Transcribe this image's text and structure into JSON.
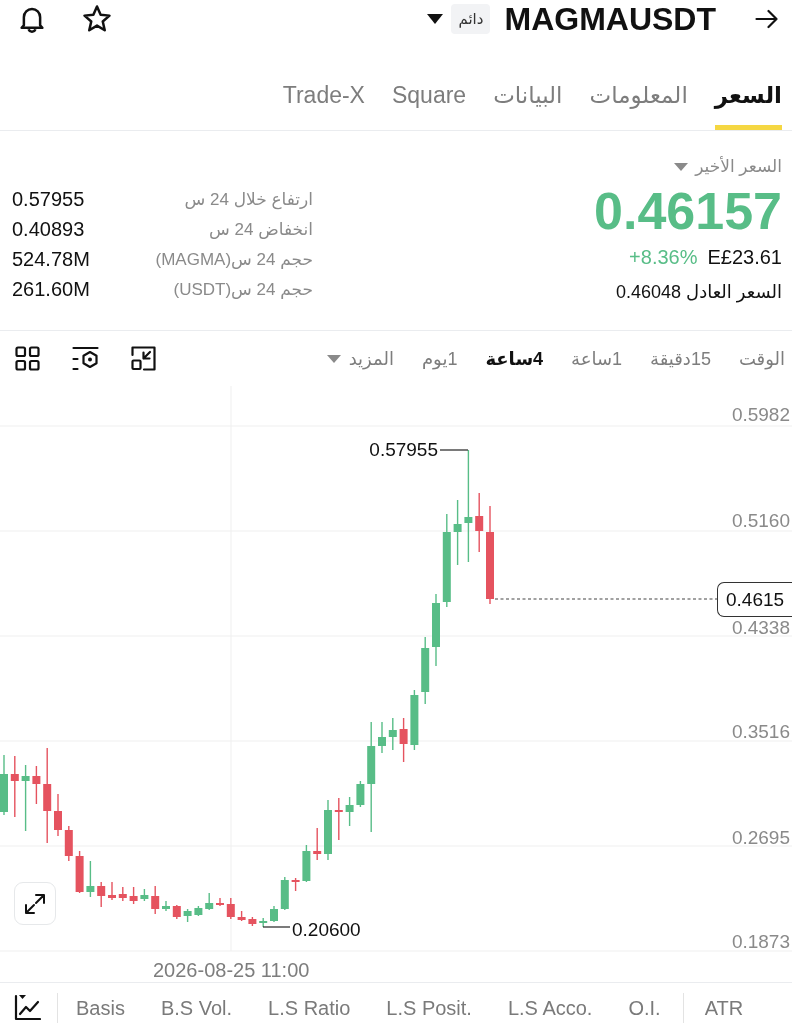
{
  "header": {
    "badge": "دائم",
    "symbol": "MAGMAUSDT"
  },
  "tabs": [
    {
      "label": "السعر",
      "selected": true
    },
    {
      "label": "المعلومات",
      "selected": false
    },
    {
      "label": "البيانات",
      "selected": false
    },
    {
      "label": "Square",
      "selected": false
    },
    {
      "label": "Trade-X",
      "selected": false
    }
  ],
  "price": {
    "caption": "السعر الأخير",
    "last": "0.46157",
    "change": "+8.36%",
    "fiat": "E£23.61",
    "fair": "السعر العادل 0.46048"
  },
  "stats": [
    {
      "label": "ارتفاع خلال 24 س",
      "value": "0.57955"
    },
    {
      "label": "انخفاض 24 س",
      "value": "0.40893"
    },
    {
      "label": "حجم 24 س(MAGMA)",
      "value": "524.78M"
    },
    {
      "label": "حجم 24 س(USDT)",
      "value": "261.60M"
    }
  ],
  "intervals": [
    {
      "label": "الوقت",
      "kind": "interval",
      "selected": false
    },
    {
      "label": "15دقيقة",
      "kind": "interval",
      "selected": false
    },
    {
      "label": "1ساعة",
      "kind": "interval",
      "selected": false
    },
    {
      "label": "4ساعة",
      "kind": "interval",
      "selected": true
    },
    {
      "label": "1يوم",
      "kind": "interval",
      "selected": false
    },
    {
      "label": "المزيد",
      "kind": "dropdown",
      "selected": false
    }
  ],
  "chart": {
    "y_axis_labels": [
      "0.5982",
      "0.5160",
      "0.4338",
      "0.3516",
      "0.2695",
      "0.1873"
    ],
    "high_label": "0.57955",
    "low_label": "0.20600",
    "price_tag": "0.4615",
    "x_axis_label": "2026-08-25 11:00"
  },
  "extra_indicators": [
    "ATR"
  ],
  "indicators": [
    "O.I.",
    "L.S Acco.",
    "L.S Posit.",
    "L.S Ratio",
    "B.S Vol.",
    "Basis"
  ]
}
